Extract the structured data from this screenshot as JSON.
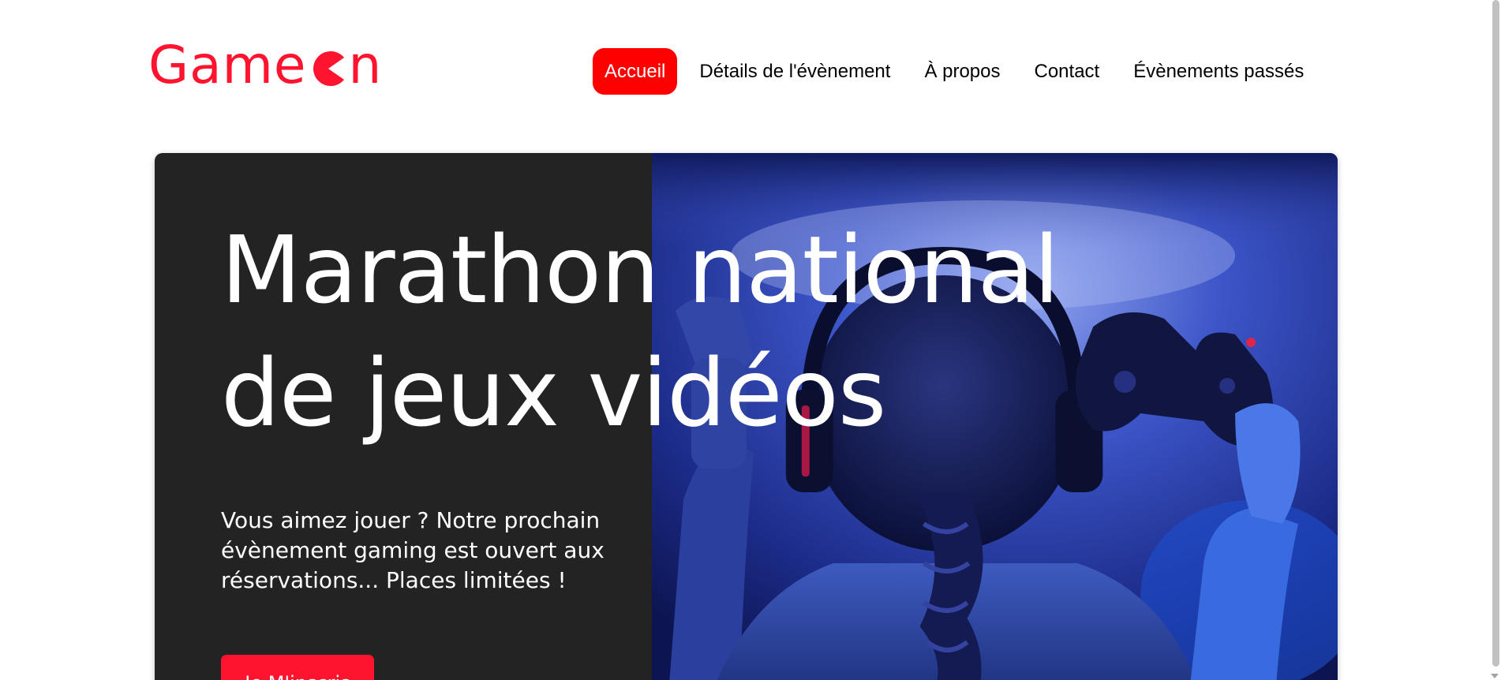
{
  "brand": {
    "logo_prefix": "Game",
    "logo_suffix": "n",
    "color": "#fe142f"
  },
  "nav": {
    "items": [
      {
        "label": "Accueil",
        "active": true
      },
      {
        "label": "Détails de l'évènement",
        "active": false
      },
      {
        "label": "À propos",
        "active": false
      },
      {
        "label": "Contact",
        "active": false
      },
      {
        "label": "Évènements passés",
        "active": false
      }
    ],
    "active_color": "#ff0000"
  },
  "hero": {
    "title_line1": "Marathon national",
    "title_line2": "de jeux vidéos",
    "text_line1": "Vous aimez jouer ? Notre prochain",
    "text_line2": "évènement gaming est ouvert aux",
    "text_line3": "réservations... Places limitées !",
    "cta_label": "Je M'inscris",
    "background": "#232323",
    "image_subject": "gamer-with-headphones-and-controller"
  }
}
